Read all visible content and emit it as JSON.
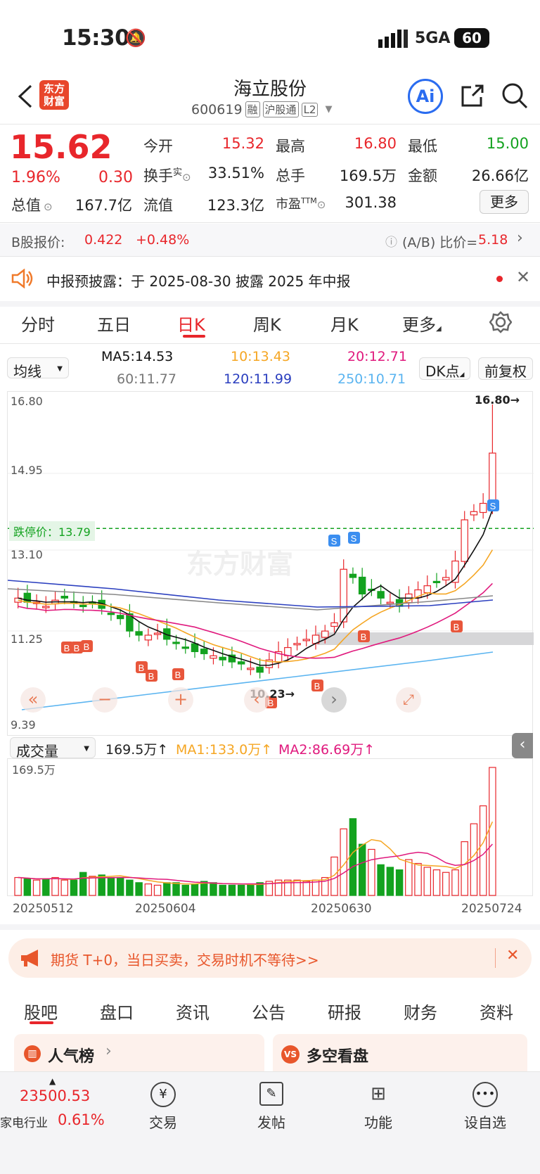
{
  "status": {
    "time": "15:30",
    "network": "5GA",
    "battery": "60"
  },
  "nav": {
    "logo_line1": "东方",
    "logo_line2": "财富",
    "title": "海立股份",
    "code": "600619",
    "badges": [
      "融",
      "沪股通",
      "L2"
    ],
    "ai_label": "Ai"
  },
  "quote": {
    "price": "15.62",
    "change_pct": "1.96%",
    "change": "0.30",
    "open_label": "今开",
    "open": "15.32",
    "high_label": "最高",
    "high": "16.80",
    "low_label": "最低",
    "low": "15.00",
    "turnover_label": "换手",
    "turnover_sup": "实",
    "turnover": "33.51%",
    "volume_label": "总手",
    "volume": "169.5万",
    "amount_label": "金额",
    "amount": "26.66亿",
    "mcap_label": "总值",
    "mcap": "167.7亿",
    "float_label": "流值",
    "float": "123.3亿",
    "pe_label": "市盈",
    "pe_sup": "TTM",
    "pe": "301.38",
    "more": "更多"
  },
  "bshare": {
    "label": "B股报价:",
    "price": "0.422",
    "change": "+0.48%",
    "ratio_label": "(A/B) 比价=",
    "ratio": "5.18"
  },
  "notice": {
    "text": "中报预披露：于 2025-08-30 披露 2025 年中报"
  },
  "tabs": [
    "分时",
    "五日",
    "日K",
    "周K",
    "月K",
    "更多"
  ],
  "active_tab": "日K",
  "ma": {
    "selector": "均线",
    "ma5": "MA5:14.53",
    "ma10": "10:13.43",
    "ma20": "20:12.71",
    "ma60": "60:11.77",
    "ma120": "120:11.99",
    "ma250": "250:10.71",
    "dk": "DK点",
    "restore": "前复权",
    "colors": {
      "ma5": "#111111",
      "ma10": "#f5a623",
      "ma20": "#e0197d",
      "ma60": "#888888",
      "ma120": "#2b3fbf",
      "ma250": "#5ab4f0"
    }
  },
  "chart_labels": {
    "y_top": "16.80",
    "y_2": "14.95",
    "y_3": "13.10",
    "y_4": "11.25",
    "y_bottom": "9.39",
    "limit_down": "跌停价：13.79",
    "max_mark": "16.80",
    "min_mark": "10.23",
    "watermark": "东方财富",
    "buy": "B",
    "sell": "S"
  },
  "volume": {
    "selector": "成交量",
    "total": "169.5万",
    "ma1": "MA1:133.0万",
    "ma2": "MA2:86.69万",
    "axis_top": "169.5万",
    "dates": [
      "20250512",
      "20250604",
      "20250630",
      "20250724"
    ]
  },
  "chart_data": {
    "type": "candlestick",
    "x_ticks": [
      "20250512",
      "20250604",
      "20250630",
      "20250724"
    ],
    "ylim": [
      9.39,
      16.8
    ],
    "high": 16.8,
    "low_in_view": 10.23,
    "limit_down_price": 13.79,
    "last": {
      "open": 15.32,
      "high": 16.8,
      "low": 15.0,
      "close": 15.62
    }
  },
  "ad": {
    "text": "期货 T+0，当日买卖，交易时机不等待>>"
  },
  "bottom_tabs": [
    "股吧",
    "盘口",
    "资讯",
    "公告",
    "研报",
    "财务",
    "资料"
  ],
  "cards": {
    "left": "人气榜",
    "right": "多空看盘"
  },
  "bottom": {
    "index": "23500.53",
    "industry": "家电行业",
    "industry_pct": "0.61%",
    "items": [
      "交易",
      "发帖",
      "功能",
      "设自选"
    ]
  }
}
